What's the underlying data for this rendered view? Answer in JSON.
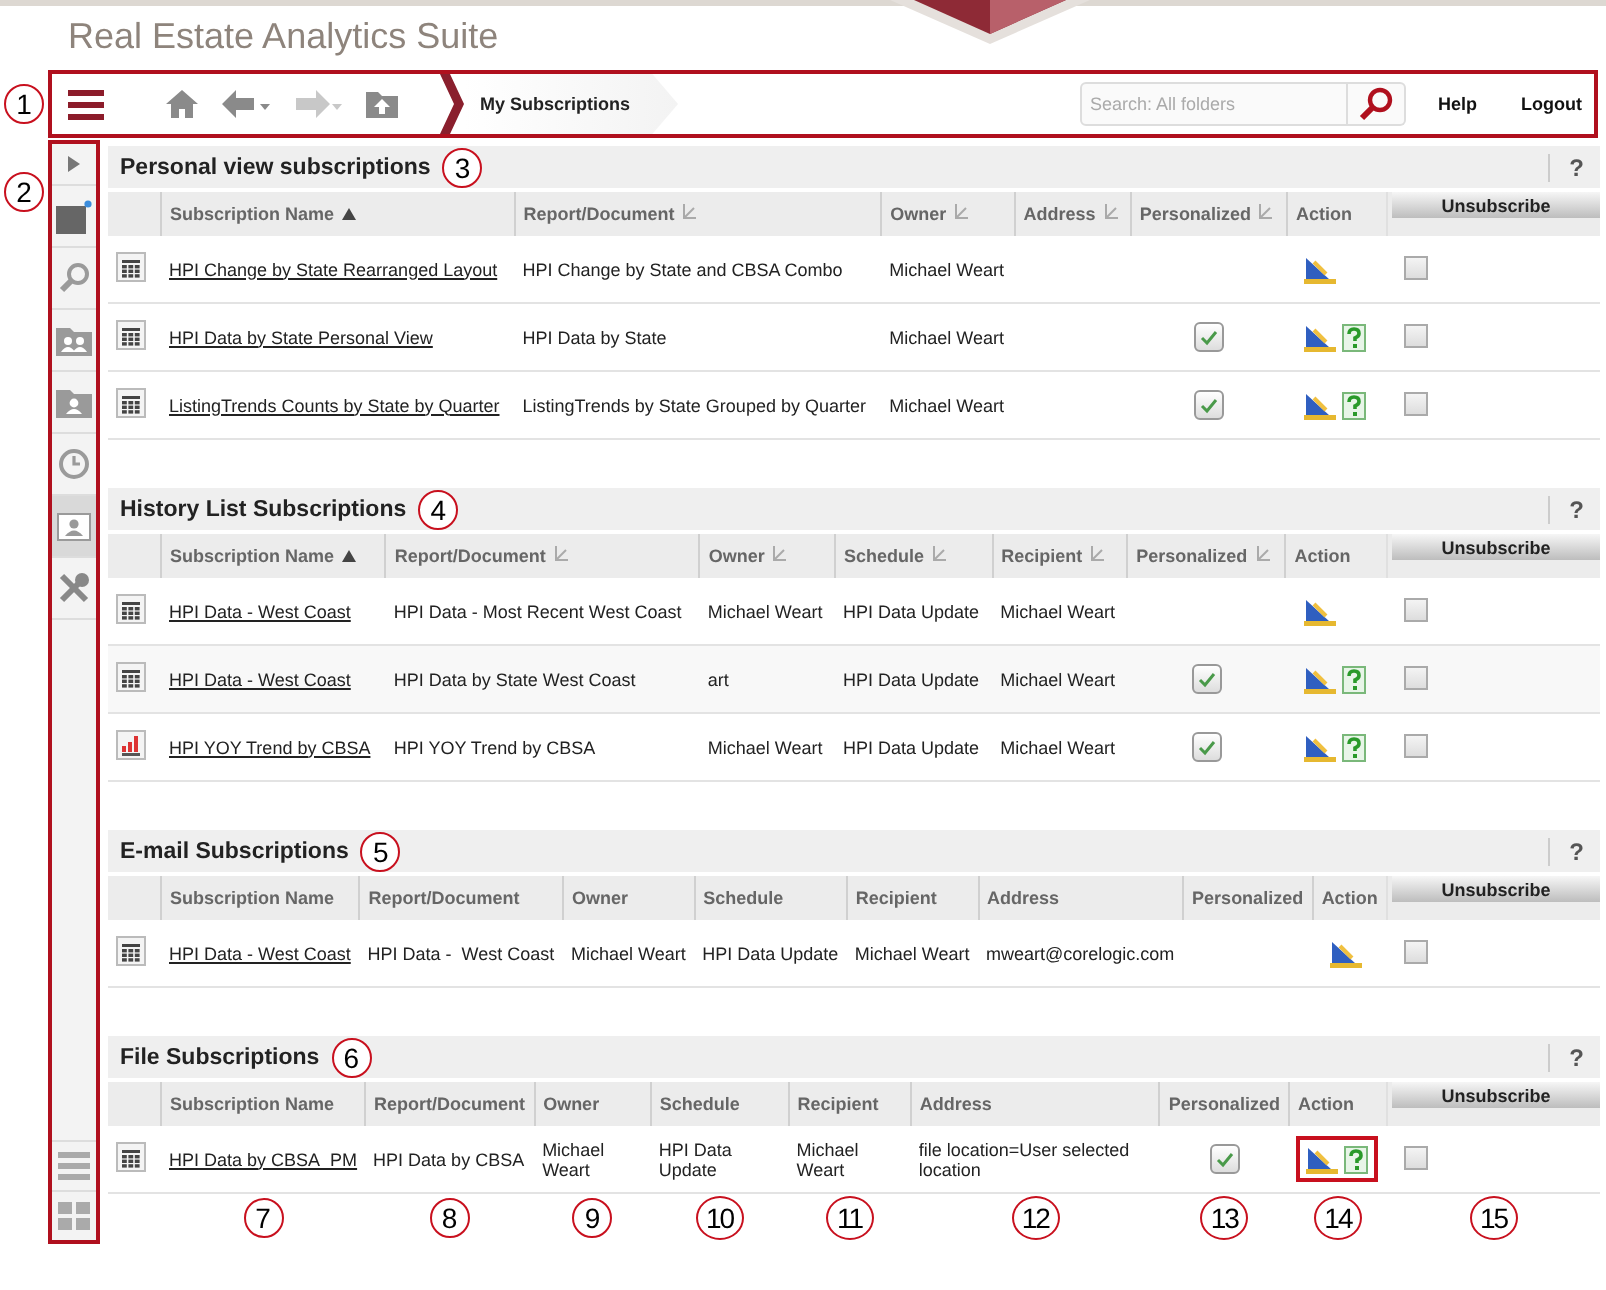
{
  "header": {
    "title": "Real Estate Analytics Suite"
  },
  "toolbar": {
    "callout": "1",
    "nav": [
      {
        "kind": "home",
        "disabled": false
      },
      {
        "kind": "back",
        "disabled": false
      },
      {
        "kind": "forward",
        "disabled": true
      },
      {
        "kind": "up",
        "disabled": false
      }
    ],
    "breadcrumb": "My Subscriptions",
    "search": {
      "placeholder": "Search: All folders"
    },
    "links": [
      "Help",
      "Logout"
    ]
  },
  "sidebar": {
    "callout": "2",
    "items": [
      {
        "kind": "expand",
        "selected": false
      },
      {
        "kind": "new",
        "selected": false
      },
      {
        "kind": "search",
        "selected": false
      },
      {
        "kind": "contacts",
        "selected": false
      },
      {
        "kind": "folder-user",
        "selected": false
      },
      {
        "kind": "history",
        "selected": false
      },
      {
        "kind": "subscriptions",
        "selected": true
      },
      {
        "kind": "tools",
        "selected": false
      }
    ],
    "bottom_items": [
      {
        "kind": "list",
        "selected": false
      },
      {
        "kind": "tiles",
        "selected": false
      }
    ]
  },
  "sections": [
    {
      "title": "Personal view subscriptions",
      "callout": "3",
      "help": "?",
      "unsubscribe_label": "Unsubscribe",
      "columns": [
        {
          "label": "Subscription Name",
          "kind": "link",
          "sorted": true
        },
        {
          "label": "Report/Document",
          "kind": "text",
          "sorted": false
        },
        {
          "label": "Owner",
          "kind": "text",
          "sorted": false
        },
        {
          "label": "Address",
          "kind": "text",
          "sorted": false
        },
        {
          "label": "Personalized",
          "kind": "check",
          "sorted": false
        },
        {
          "label": "Action",
          "kind": "actions"
        }
      ],
      "rows": [
        {
          "kind": "grid",
          "cells": [
            "HPI Change by State Rearranged Layout",
            "HPI Change by State and CBSA Combo",
            "Michael Weart",
            "",
            false,
            [
              {
                "kind": "edit"
              }
            ]
          ],
          "unsubscribe": false,
          "actions_highlighted": false
        },
        {
          "kind": "grid",
          "cells": [
            "HPI Data by State Personal View",
            "HPI Data by State",
            "Michael Weart",
            "",
            true,
            [
              {
                "kind": "edit"
              },
              {
                "kind": "help"
              }
            ]
          ],
          "unsubscribe": false,
          "actions_highlighted": false
        },
        {
          "kind": "grid",
          "cells": [
            "ListingTrends Counts by State by Quarter",
            "ListingTrends by State Grouped by Quarter",
            "Michael Weart",
            "",
            true,
            [
              {
                "kind": "edit"
              },
              {
                "kind": "help"
              }
            ]
          ],
          "unsubscribe": false,
          "actions_highlighted": false
        }
      ]
    },
    {
      "title": "History List Subscriptions",
      "callout": "4",
      "help": "?",
      "unsubscribe_label": "Unsubscribe",
      "columns": [
        {
          "label": "Subscription Name",
          "kind": "link",
          "sorted": true
        },
        {
          "label": "Report/Document",
          "kind": "text",
          "sorted": false
        },
        {
          "label": "Owner",
          "kind": "text",
          "sorted": false
        },
        {
          "label": "Schedule",
          "kind": "text",
          "sorted": false
        },
        {
          "label": "Recipient",
          "kind": "text",
          "sorted": false
        },
        {
          "label": "Personalized",
          "kind": "check",
          "sorted": false
        },
        {
          "label": "Action",
          "kind": "actions"
        }
      ],
      "rows": [
        {
          "kind": "grid",
          "cells": [
            "HPI Data - West Coast",
            "HPI Data - Most Recent West Coast",
            "Michael Weart",
            "HPI Data Update",
            "Michael Weart",
            false,
            [
              {
                "kind": "edit"
              }
            ]
          ],
          "unsubscribe": false,
          "actions_highlighted": false
        },
        {
          "kind": "grid",
          "cells": [
            "HPI Data - West Coast",
            "HPI Data by State West Coast",
            "art",
            "HPI Data Update",
            "Michael Weart",
            true,
            [
              {
                "kind": "edit"
              },
              {
                "kind": "help"
              }
            ]
          ],
          "unsubscribe": false,
          "actions_highlighted": false
        },
        {
          "kind": "chart",
          "cells": [
            "HPI YOY Trend by CBSA",
            "HPI YOY Trend by CBSA",
            "Michael Weart",
            "HPI Data Update",
            "Michael Weart",
            true,
            [
              {
                "kind": "edit"
              },
              {
                "kind": "help"
              }
            ]
          ],
          "unsubscribe": false,
          "actions_highlighted": false
        }
      ]
    },
    {
      "title": "E-mail Subscriptions",
      "callout": "5",
      "help": "?",
      "unsubscribe_label": "Unsubscribe",
      "columns": [
        {
          "label": "Subscription Name",
          "kind": "link"
        },
        {
          "label": "Report/Document",
          "kind": "text"
        },
        {
          "label": "Owner",
          "kind": "text"
        },
        {
          "label": "Schedule",
          "kind": "text"
        },
        {
          "label": "Recipient",
          "kind": "text"
        },
        {
          "label": "Address",
          "kind": "text"
        },
        {
          "label": "Personalized",
          "kind": "check"
        },
        {
          "label": "Action",
          "kind": "actions"
        }
      ],
      "rows": [
        {
          "kind": "grid",
          "cells": [
            "HPI Data - West Coast",
            "HPI Data -  West Coast",
            "Michael Weart",
            "HPI Data Update",
            "Michael Weart",
            "mweart@corelogic.com",
            false,
            [
              {
                "kind": "edit"
              }
            ]
          ],
          "unsubscribe": false,
          "actions_highlighted": false
        }
      ]
    },
    {
      "title": "File Subscriptions",
      "callout": "6",
      "help": "?",
      "unsubscribe_label": "Unsubscribe",
      "columns": [
        {
          "label": "Subscription Name",
          "kind": "link"
        },
        {
          "label": "Report/Document",
          "kind": "text"
        },
        {
          "label": "Owner",
          "kind": "text"
        },
        {
          "label": "Schedule",
          "kind": "text"
        },
        {
          "label": "Recipient",
          "kind": "text"
        },
        {
          "label": "Address",
          "kind": "text"
        },
        {
          "label": "Personalized",
          "kind": "check"
        },
        {
          "label": "Action",
          "kind": "actions"
        }
      ],
      "rows": [
        {
          "kind": "grid",
          "cells": [
            "HPI Data by CBSA_PM",
            "HPI Data by CBSA",
            "Michael Weart",
            "HPI Data Update",
            "Michael Weart",
            "file location=User selected location",
            true,
            [
              {
                "kind": "edit"
              },
              {
                "kind": "help"
              }
            ]
          ],
          "unsubscribe": false,
          "actions_highlighted": true
        }
      ],
      "column_callouts": [
        "7",
        "8",
        "9",
        "10",
        "11",
        "12",
        "13",
        "14",
        "15"
      ]
    }
  ]
}
